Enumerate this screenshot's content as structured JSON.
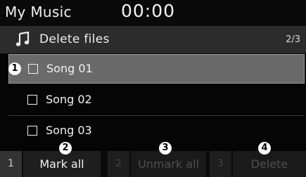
{
  "app": {
    "title": "My Music",
    "clock": "00:00"
  },
  "header": {
    "title": "Delete files",
    "page": "2/3",
    "icon": "music-note-icon"
  },
  "songs": [
    {
      "label": "Song 01",
      "checked": false,
      "selected": true
    },
    {
      "label": "Song 02",
      "checked": false,
      "selected": false
    },
    {
      "label": "Song 03",
      "checked": false,
      "selected": false
    }
  ],
  "footer": {
    "keys": [
      {
        "number": "1",
        "label": "Mark all",
        "enabled": true
      },
      {
        "number": "2",
        "label": "Unmark all",
        "enabled": false
      },
      {
        "number": "3",
        "label": "Delete",
        "enabled": false
      }
    ]
  },
  "callouts": [
    "1",
    "2",
    "3",
    "4"
  ]
}
